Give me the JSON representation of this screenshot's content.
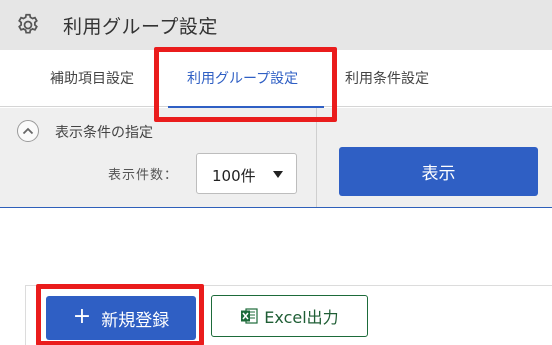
{
  "window": {
    "title": "利用グループ設定"
  },
  "tabs": [
    {
      "label": "補助項目設定"
    },
    {
      "label": "利用グループ設定",
      "active": true
    },
    {
      "label": "利用条件設定"
    }
  ],
  "filter": {
    "section_label": "表示条件の指定",
    "count_label": "表示件数：",
    "count_value": "100件",
    "show_button": "表示"
  },
  "actions": {
    "new_button": "新規登録",
    "excel_button": "Excel出力"
  },
  "colors": {
    "accent": "#2f5fc4",
    "highlight": "#ea1c1c",
    "excel": "#1d6b3a"
  }
}
